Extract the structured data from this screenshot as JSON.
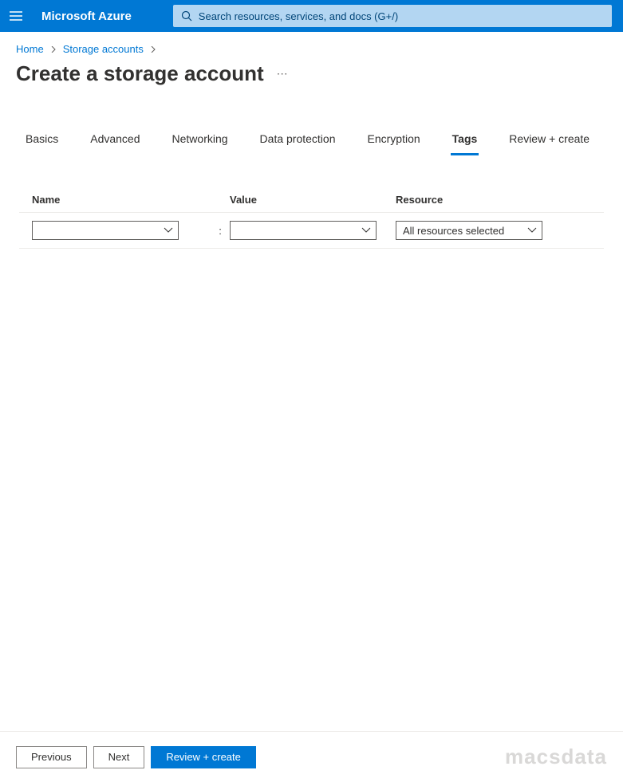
{
  "header": {
    "brand": "Microsoft Azure",
    "search_placeholder": "Search resources, services, and docs (G+/)"
  },
  "breadcrumb": {
    "items": [
      "Home",
      "Storage accounts"
    ]
  },
  "page": {
    "title": "Create a storage account"
  },
  "tabs": {
    "items": [
      {
        "label": "Basics"
      },
      {
        "label": "Advanced"
      },
      {
        "label": "Networking"
      },
      {
        "label": "Data protection"
      },
      {
        "label": "Encryption"
      },
      {
        "label": "Tags"
      },
      {
        "label": "Review + create"
      }
    ],
    "active_index": 5
  },
  "tags_table": {
    "columns": {
      "name": "Name",
      "value": "Value",
      "resource": "Resource"
    },
    "row": {
      "name_value": "",
      "value_value": "",
      "resource_value": "All resources selected"
    }
  },
  "footer": {
    "previous": "Previous",
    "next": "Next",
    "review": "Review + create"
  },
  "watermark": "macsdata"
}
